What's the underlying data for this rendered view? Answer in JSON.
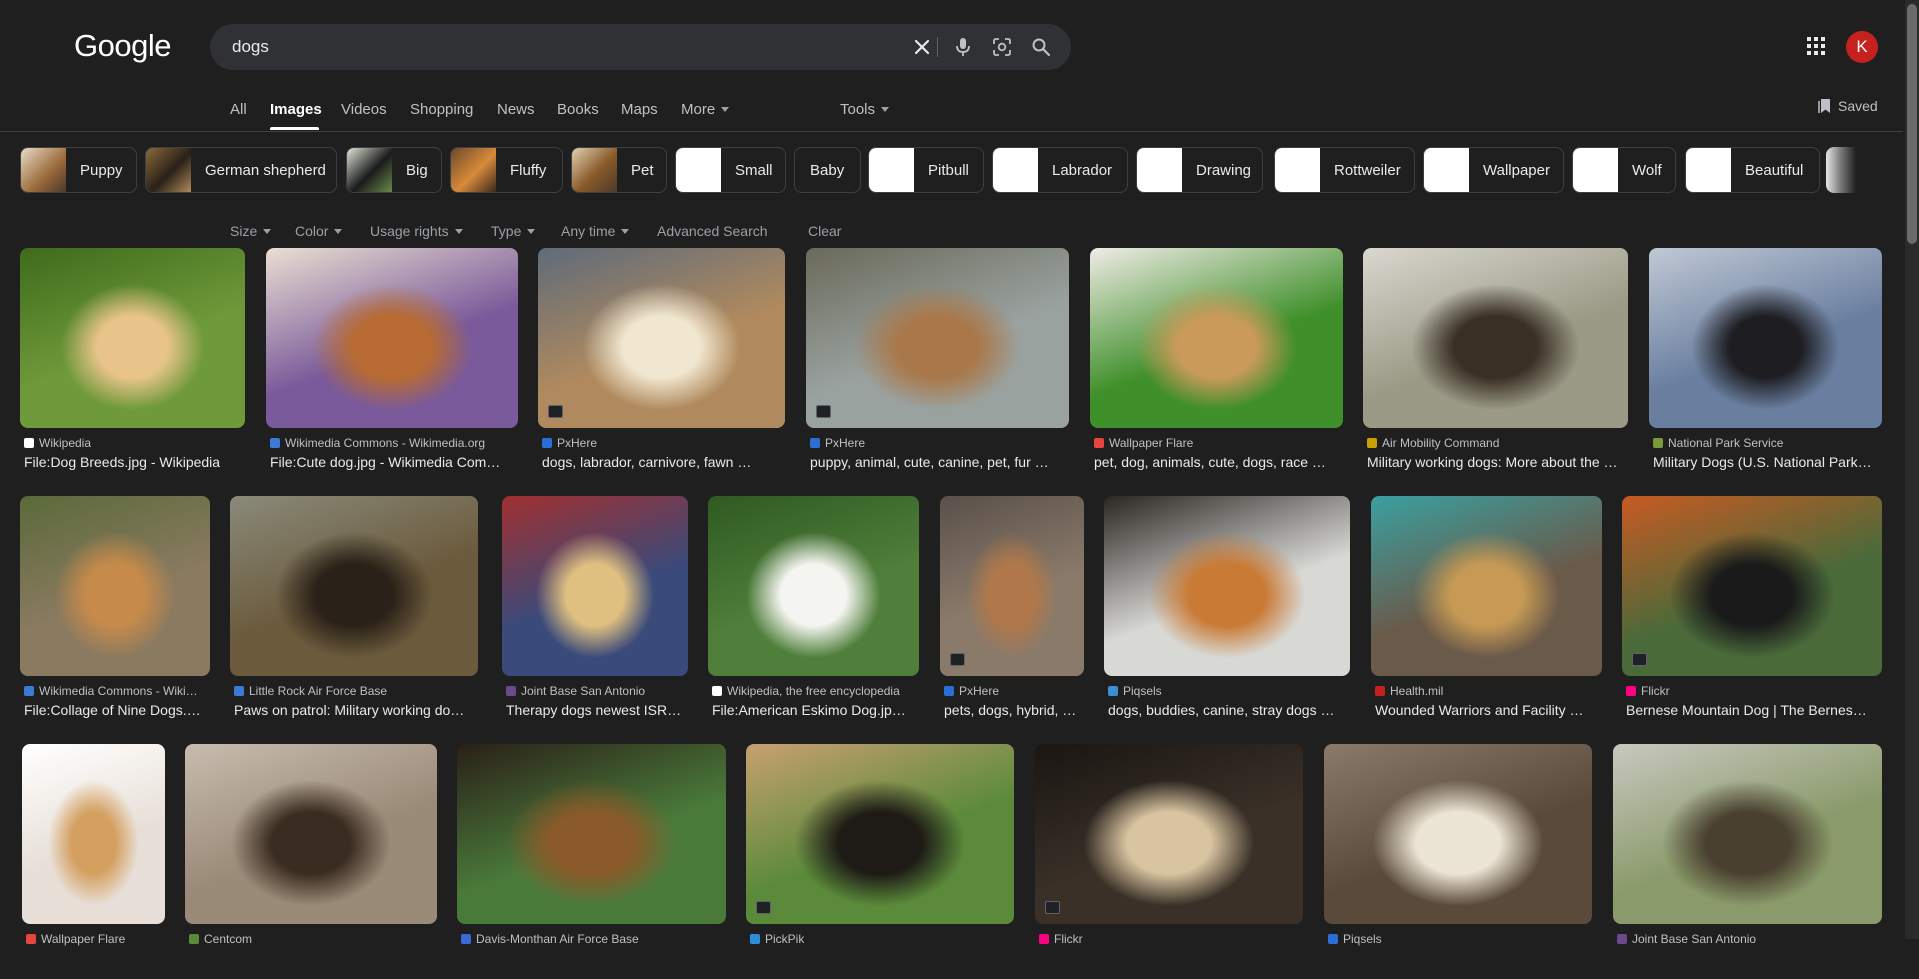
{
  "header": {
    "logo_text": "Google",
    "search_value": "dogs",
    "avatar_letter": "K"
  },
  "nav": {
    "tabs": [
      "All",
      "Images",
      "Videos",
      "Shopping",
      "News",
      "Books",
      "Maps",
      "More"
    ],
    "active_tab": "Images",
    "tools_label": "Tools",
    "saved_label": "Saved"
  },
  "chips": [
    "Puppy",
    "German shepherd",
    "Big",
    "Fluffy",
    "Pet",
    "Small",
    "Baby",
    "Pitbull",
    "Labrador",
    "Drawing",
    "Rottweiler",
    "Wallpaper",
    "Wolf",
    "Beautiful"
  ],
  "filters": {
    "size": "Size",
    "color": "Color",
    "usage_rights": "Usage rights",
    "type": "Type",
    "any_time": "Any time",
    "advanced_search": "Advanced Search",
    "clear": "Clear"
  },
  "results": [
    {
      "source": "Wikipedia",
      "title": "File:Dog Breeds.jpg - Wikipedia",
      "colors": [
        "#6f9a3a",
        "#e9c48a",
        "#3f6b1c"
      ]
    },
    {
      "source": "Wikimedia Commons - Wikimedia.org",
      "title": "File:Cute dog.jpg - Wikimedia Com…",
      "colors": [
        "#7a5a9a",
        "#b86b32",
        "#eadfd2"
      ]
    },
    {
      "source": "PxHere",
      "title": "dogs, labrador, carnivore, fawn …",
      "colors": [
        "#b08a5e",
        "#f1e6cf",
        "#5f6b7a"
      ]
    },
    {
      "source": "PxHere",
      "title": "puppy, animal, cute, canine, pet, fur …",
      "colors": [
        "#9aa2a0",
        "#a9784a",
        "#6a6a5a"
      ]
    },
    {
      "source": "Wallpaper Flare",
      "title": "pet, dog, animals, cute, dogs, race …",
      "colors": [
        "#3f8f2a",
        "#c99a5a",
        "#f0ece6"
      ]
    },
    {
      "source": "Air Mobility Command",
      "title": "Military working dogs: More about the …",
      "colors": [
        "#9a9a86",
        "#3a2f24",
        "#d9d7cf"
      ]
    },
    {
      "source": "National Park Service",
      "title": "Military Dogs (U.S. National Park…",
      "colors": [
        "#6a7fa0",
        "#1e1e22",
        "#c0c8d4"
      ]
    },
    {
      "source": "Wikimedia Commons - Wiki…",
      "title": "File:Collage of Nine Dogs.…",
      "colors": [
        "#8a7a60",
        "#c68a4a",
        "#5a6a3a"
      ]
    },
    {
      "source": "Little Rock Air Force Base",
      "title": "Paws on patrol: Military working do…",
      "colors": [
        "#6b5a3c",
        "#2a2118",
        "#8a8a7a"
      ]
    },
    {
      "source": "Joint Base San Antonio",
      "title": "Therapy dogs newest ISR…",
      "colors": [
        "#3a4a7a",
        "#e0c080",
        "#a03030"
      ]
    },
    {
      "source": "Wikipedia, the free encyclopedia",
      "title": "File:American Eskimo Dog.jp…",
      "colors": [
        "#4f7f3a",
        "#f4f4f0",
        "#2f5a22"
      ]
    },
    {
      "source": "PxHere",
      "title": "pets, dogs, hybrid, …",
      "colors": [
        "#8a7a6a",
        "#b0784a",
        "#5a504a"
      ]
    },
    {
      "source": "Piqsels",
      "title": "dogs, buddies, canine, stray dogs …",
      "colors": [
        "#d8d8d4",
        "#c97a34",
        "#2a2622"
      ]
    },
    {
      "source": "Health.mil",
      "title": "Wounded Warriors and Facility …",
      "colors": [
        "#6a5a4a",
        "#c69a54",
        "#3aa0a0"
      ]
    },
    {
      "source": "Flickr",
      "title": "Bernese Mountain Dog | The Bernes…",
      "colors": [
        "#4a6a3a",
        "#1a1a1a",
        "#c85a22"
      ]
    },
    {
      "source": "Wallpaper Flare",
      "title": "",
      "colors": [
        "#e8e0d8",
        "#d4a060",
        "#ffffff"
      ]
    },
    {
      "source": "Centcom",
      "title": "",
      "colors": [
        "#9a8a78",
        "#3a2c20",
        "#c8bcae"
      ]
    },
    {
      "source": "Davis-Monthan Air Force Base",
      "title": "",
      "colors": [
        "#4a7a3a",
        "#8a5a2a",
        "#2a2018"
      ]
    },
    {
      "source": "PickPik",
      "title": "",
      "colors": [
        "#5a8a3a",
        "#1e1a16",
        "#c8a070"
      ]
    },
    {
      "source": "Flickr",
      "title": "",
      "colors": [
        "#3a3028",
        "#d8c4a0",
        "#1a1612"
      ]
    },
    {
      "source": "Piqsels",
      "title": "",
      "colors": [
        "#5a4a3a",
        "#ece4d4",
        "#8a7a6a"
      ]
    },
    {
      "source": "Joint Base San Antonio",
      "title": "",
      "colors": [
        "#8a9a6a",
        "#4a4030",
        "#c8c8c0"
      ]
    }
  ],
  "colors": {
    "background": "#1f1f1f",
    "searchbox": "#303134",
    "avatar": "#c5221f"
  },
  "icons": [
    "clear-icon",
    "microphone-icon",
    "lens-icon",
    "search-icon",
    "apps-grid-icon",
    "bookmark-icon",
    "caret-down-icon"
  ]
}
